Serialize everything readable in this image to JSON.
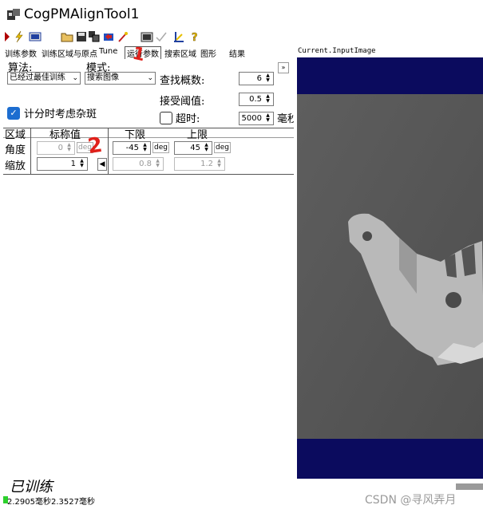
{
  "window": {
    "title": "CogPMAlignTool1"
  },
  "tabs": [
    {
      "label": "训练参数"
    },
    {
      "label": "训练区域与原点"
    },
    {
      "label": "Tune"
    },
    {
      "label": "运行参数",
      "active": true
    },
    {
      "label": "搜索区域"
    },
    {
      "label": "图形"
    },
    {
      "label": "结果"
    }
  ],
  "run_params": {
    "algorithm_label": "算法:",
    "algorithm_value": "已经过最佳训练",
    "mode_label": "模式:",
    "mode_value": "搜索图像",
    "find_count_label": "查找概数:",
    "find_count_value": "6",
    "accept_threshold_label": "接受阈值:",
    "accept_threshold_value": "0.5",
    "timeout_label": "超时:",
    "timeout_value": "5000",
    "timeout_unit": "毫秒",
    "timeout_checked": false,
    "clutter_label": "计分时考虑杂斑",
    "clutter_checked": true
  },
  "dof_table": {
    "headers": [
      "区域",
      "标称值",
      "下限",
      "上限"
    ],
    "rows": [
      {
        "name": "角度",
        "nominal": "0",
        "nominal_unit": "deg",
        "low": "-45",
        "low_unit": "deg",
        "high": "45",
        "high_unit": "deg"
      },
      {
        "name": "缩放",
        "nominal": "1",
        "low": "0.8",
        "high": "1.2"
      }
    ]
  },
  "annotations": {
    "mark1": "1",
    "mark2": "2"
  },
  "image_pane": {
    "title": "Current.InputImage"
  },
  "status": {
    "trained_text": "已训练",
    "timing_text": "2.2905毫秒2.3527毫秒"
  },
  "watermark": "CSDN @寻风弄月",
  "colors": {
    "navy": "#0b0b5e",
    "checkbox_blue": "#1c6dd0",
    "red_mark": "#e0201a"
  }
}
